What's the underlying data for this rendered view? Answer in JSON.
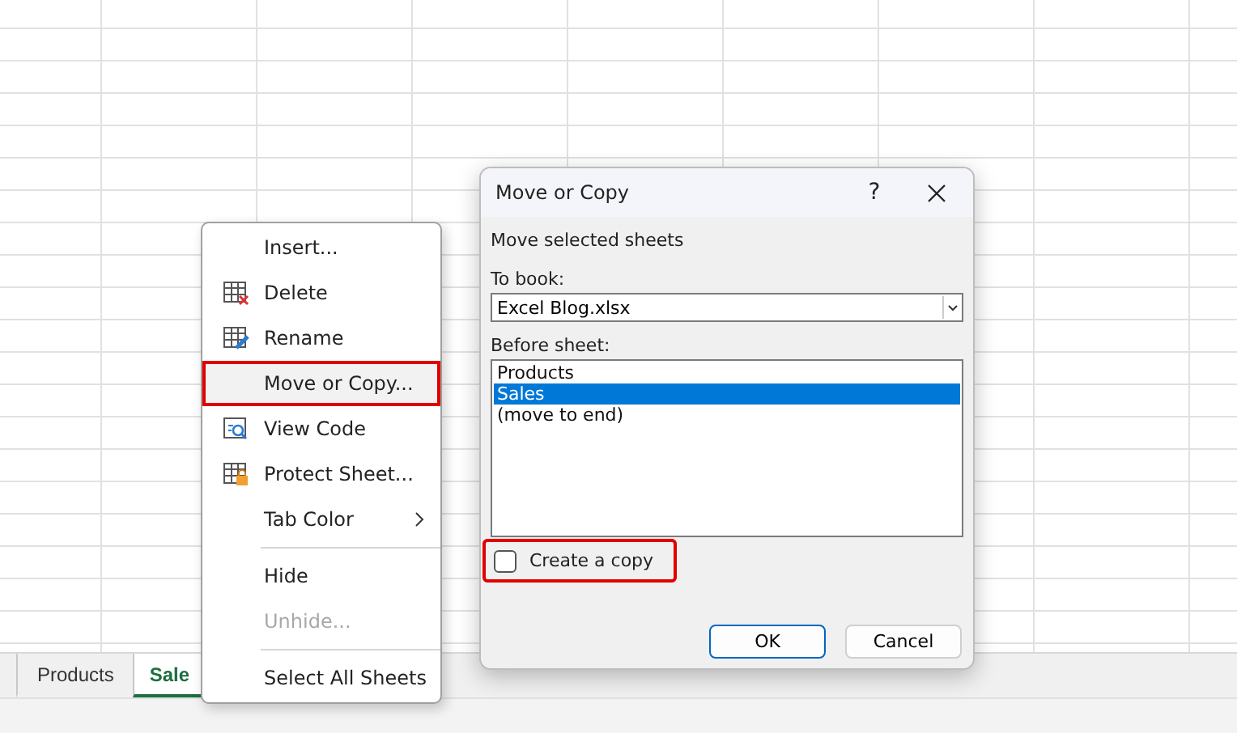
{
  "sheet_tabs": [
    {
      "label": "Products",
      "selected": false
    },
    {
      "label": "Sale",
      "selected": true
    }
  ],
  "context_menu": {
    "items": [
      {
        "kind": "item",
        "label": "Insert...",
        "disabled": false,
        "highlighted": false
      },
      {
        "kind": "item",
        "label": "Delete",
        "disabled": false,
        "highlighted": false
      },
      {
        "kind": "item",
        "label": "Rename",
        "disabled": false,
        "highlighted": false
      },
      {
        "kind": "item",
        "label": "Move or Copy...",
        "disabled": false,
        "highlighted": true
      },
      {
        "kind": "item",
        "label": "View Code",
        "disabled": false,
        "highlighted": false
      },
      {
        "kind": "item",
        "label": "Protect Sheet...",
        "disabled": false,
        "highlighted": false
      },
      {
        "kind": "submenu",
        "label": "Tab Color",
        "disabled": false,
        "highlighted": false
      },
      {
        "kind": "separator"
      },
      {
        "kind": "item",
        "label": "Hide",
        "disabled": false,
        "highlighted": false
      },
      {
        "kind": "item",
        "label": "Unhide...",
        "disabled": true,
        "highlighted": false
      },
      {
        "kind": "separator"
      },
      {
        "kind": "item",
        "label": "Select All Sheets",
        "disabled": false,
        "highlighted": false
      }
    ]
  },
  "dialog": {
    "title": "Move or Copy",
    "help": "?",
    "heading": "Move selected sheets",
    "to_book_label": "To book:",
    "to_book_value": "Excel Blog.xlsx",
    "before_sheet_label": "Before sheet:",
    "before_sheet_items": [
      {
        "label": "Products",
        "selected": false
      },
      {
        "label": "Sales",
        "selected": true
      },
      {
        "label": "(move to end)",
        "selected": false
      }
    ],
    "create_copy": {
      "label": "Create a copy",
      "checked": false,
      "highlighted": true
    },
    "buttons": [
      {
        "label": "OK",
        "default": true
      },
      {
        "label": "Cancel",
        "default": false
      }
    ]
  }
}
